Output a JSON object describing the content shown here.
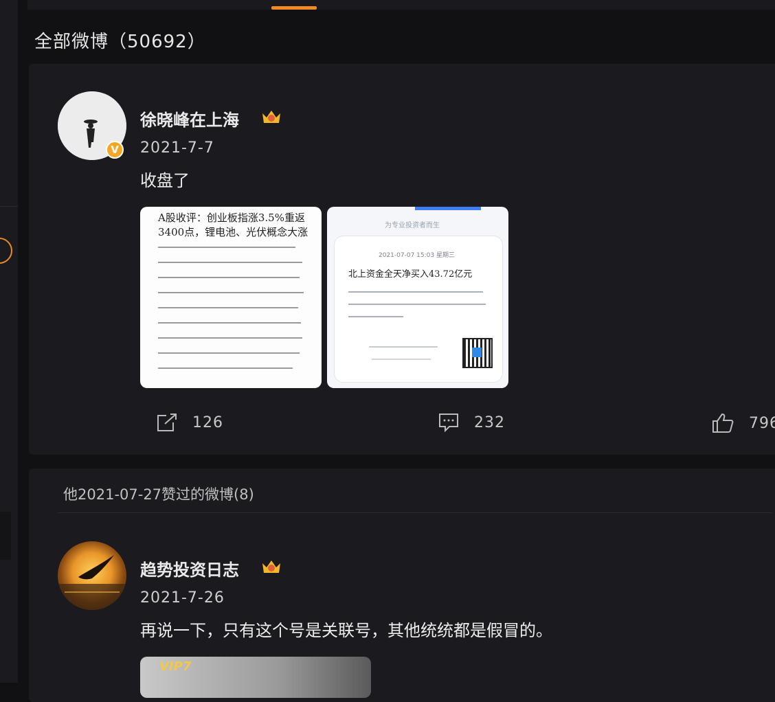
{
  "section": {
    "title": "全部微博（50692）"
  },
  "post1": {
    "user": "徐晓峰在上海",
    "verified_badge": "V",
    "date": "2021-7-7",
    "content": "收盘了",
    "image1": {
      "headline": "A股收评：创业板指涨3.5%重返3400点，锂电池、光伏概念大涨"
    },
    "image2": {
      "header": "为专业投资者而生",
      "date_line": "2021-07-07 15:03 星期三",
      "headline": "北上资金全天净买入43.72亿元"
    },
    "actions": {
      "repost_count": "126",
      "comment_count": "232",
      "like_count": "796"
    }
  },
  "liked": {
    "title": "他2021-07-27赞过的微博(8)",
    "post": {
      "user": "趋势投资日志",
      "date": "2021-7-26",
      "content": "再说一下，只有这个号是关联号，其他统统都是假冒的。",
      "preview_label": "VIP7"
    }
  },
  "colors": {
    "accent": "#f08a24",
    "badge": "#f6a623",
    "background": "#111113",
    "card": "#1b1b1f"
  }
}
